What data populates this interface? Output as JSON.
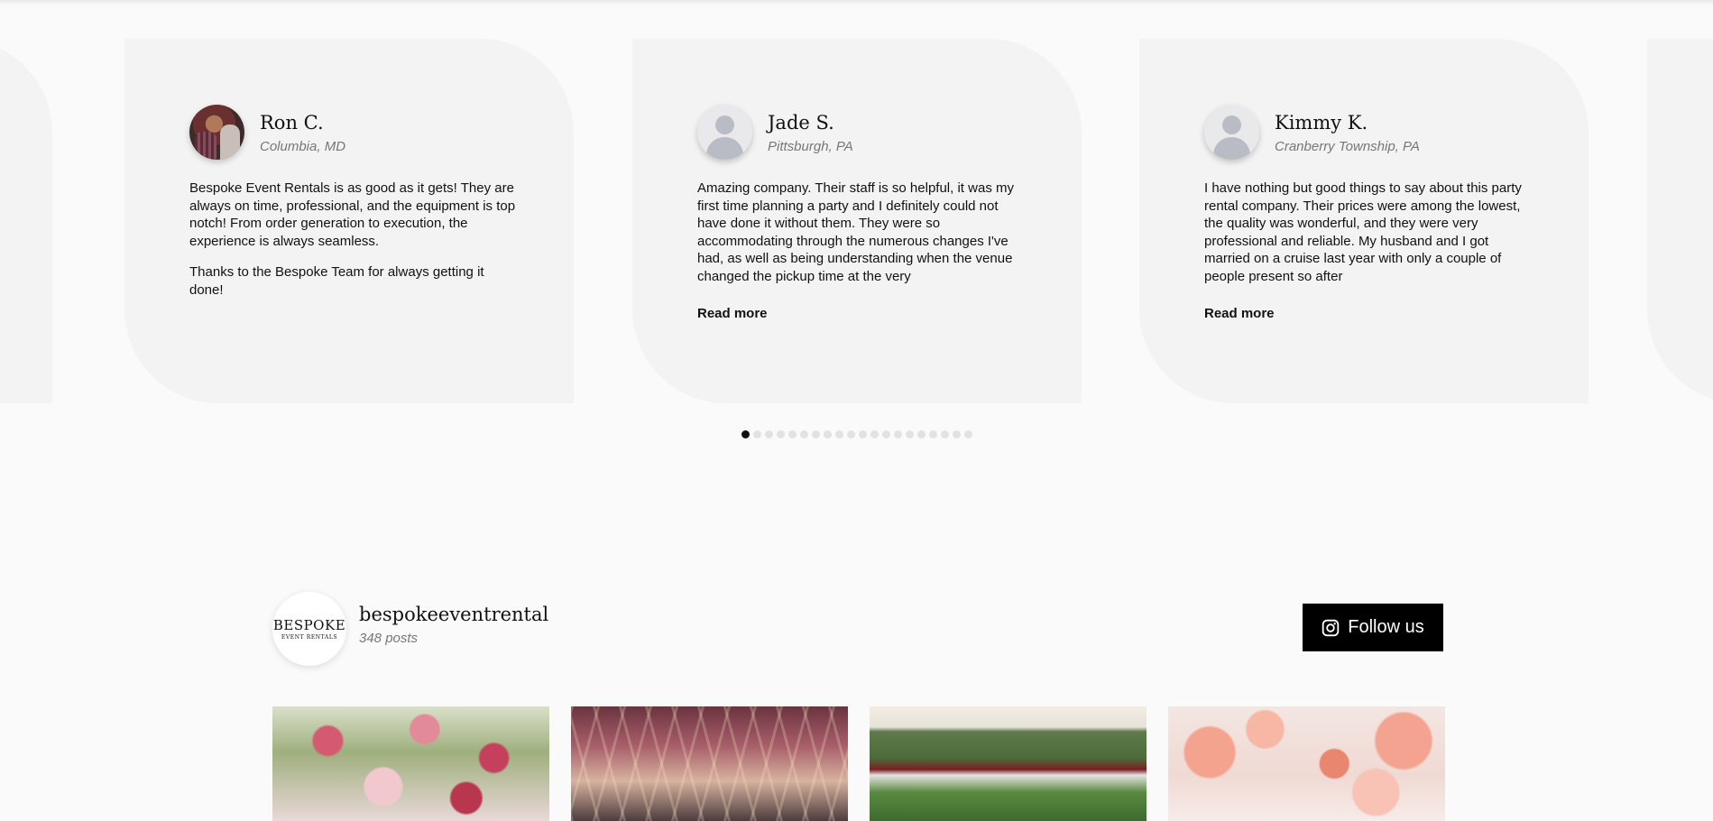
{
  "testimonials": [
    {
      "name": "Ron C.",
      "location": "Columbia, MD",
      "avatar": "customer-photo",
      "paragraphs": [
        "Bespoke Event Rentals is as good as it gets! They are always on time, professional, and the equipment is top notch! From order generation to execution, the experience is always seamless.",
        "Thanks to the Bespoke Team for always getting it done!"
      ],
      "read_more": ""
    },
    {
      "name": "Jade S.",
      "location": "Pittsburgh, PA",
      "avatar": "default-user-icon",
      "paragraphs": [
        "Amazing company. Their staff is so helpful, it was my first time planning a party and I definitely could not have done it without them. They were so accommodating through the numerous changes I've had, as well as being understanding when the venue changed the pickup time at the very"
      ],
      "read_more": "Read more"
    },
    {
      "name": "Kimmy K.",
      "location": "Cranberry Township, PA",
      "avatar": "default-user-icon",
      "paragraphs": [
        "I have nothing but good things to say about this party rental company. Their prices were among the lowest, the quality was wonderful, and they were very professional and reliable. My husband and I got married on a cruise last year with only a couple of people present so after"
      ],
      "read_more": "Read more"
    }
  ],
  "carousel": {
    "dot_count": 20,
    "active_index": 0
  },
  "instagram": {
    "logo_line1": "BESPOKE",
    "logo_line2": "EVENT RENTALS",
    "handle": "bespokeeventrental",
    "posts": "348 posts",
    "follow_label": "Follow us",
    "follow_icon": "instagram-icon",
    "tiles": [
      "floral-arrangement-photo",
      "string-lights-tent-photo",
      "aerial-venue-photo",
      "pink-floral-backdrop-photo"
    ]
  },
  "colors": {
    "page_bg": "#fafafa",
    "card_bg": "#f3f3f3",
    "button_bg": "#000000",
    "dot_active": "#111111",
    "dot_inactive": "#e2e2e2"
  }
}
